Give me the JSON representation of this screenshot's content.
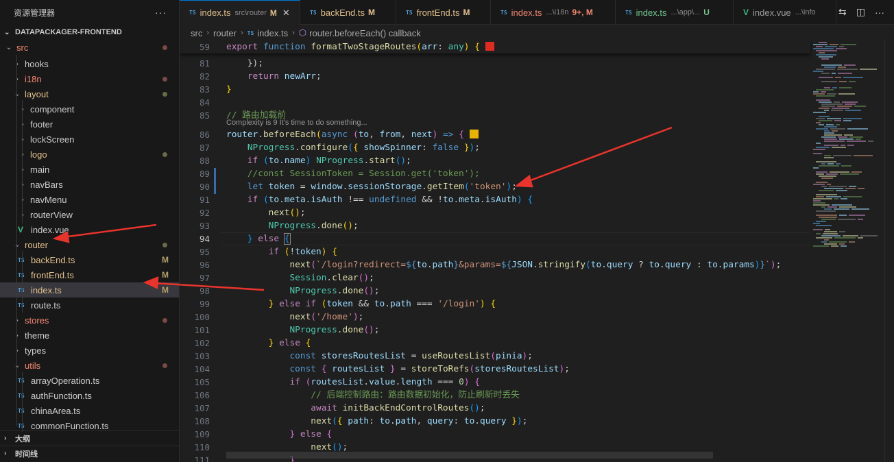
{
  "sidebar": {
    "title": "资源管理器",
    "more": "···",
    "project": "DATAPACKAGER-FRONTEND",
    "items": [
      {
        "label": "src",
        "kind": "folder-open",
        "state": "err"
      },
      {
        "label": "hooks",
        "kind": "folder",
        "state": ""
      },
      {
        "label": "i18n",
        "kind": "folder",
        "state": "err"
      },
      {
        "label": "layout",
        "kind": "folder-open",
        "state": "mod"
      },
      {
        "label": "component",
        "kind": "folder",
        "state": ""
      },
      {
        "label": "footer",
        "kind": "folder",
        "state": ""
      },
      {
        "label": "lockScreen",
        "kind": "folder",
        "state": ""
      },
      {
        "label": "logo",
        "kind": "folder",
        "state": "mod"
      },
      {
        "label": "main",
        "kind": "folder",
        "state": ""
      },
      {
        "label": "navBars",
        "kind": "folder",
        "state": ""
      },
      {
        "label": "navMenu",
        "kind": "folder",
        "state": ""
      },
      {
        "label": "routerView",
        "kind": "folder",
        "state": ""
      },
      {
        "label": "index.vue",
        "kind": "vue",
        "state": ""
      },
      {
        "label": "router",
        "kind": "folder-open",
        "state": "mod"
      },
      {
        "label": "backEnd.ts",
        "kind": "ts",
        "state": "mod",
        "badge": "M"
      },
      {
        "label": "frontEnd.ts",
        "kind": "ts",
        "state": "mod",
        "badge": "M"
      },
      {
        "label": "index.ts",
        "kind": "ts",
        "state": "mod",
        "badge": "M"
      },
      {
        "label": "route.ts",
        "kind": "ts",
        "state": ""
      },
      {
        "label": "stores",
        "kind": "folder",
        "state": "err"
      },
      {
        "label": "theme",
        "kind": "folder",
        "state": ""
      },
      {
        "label": "types",
        "kind": "folder",
        "state": ""
      },
      {
        "label": "utils",
        "kind": "folder-open",
        "state": "err"
      },
      {
        "label": "arrayOperation.ts",
        "kind": "ts",
        "state": ""
      },
      {
        "label": "authFunction.ts",
        "kind": "ts",
        "state": ""
      },
      {
        "label": "chinaArea.ts",
        "kind": "ts",
        "state": ""
      },
      {
        "label": "commonFunction.ts",
        "kind": "ts",
        "state": ""
      }
    ],
    "outline": "大纲",
    "timeline": "时间线"
  },
  "tabs": [
    {
      "icon": "TS",
      "name": "index.ts",
      "path": "src\\router",
      "status": "M",
      "active": true,
      "state": "mod"
    },
    {
      "icon": "TS",
      "name": "backEnd.ts",
      "path": "",
      "status": "M",
      "active": false,
      "state": "mod"
    },
    {
      "icon": "TS",
      "name": "frontEnd.ts",
      "path": "",
      "status": "M",
      "active": false,
      "state": "mod"
    },
    {
      "icon": "TS",
      "name": "index.ts",
      "path": "...\\i18n",
      "status": "9+, M",
      "active": false,
      "state": "err"
    },
    {
      "icon": "TS",
      "name": "index.ts",
      "path": "...\\app\\...",
      "status": "U",
      "active": false,
      "state": "unt"
    },
    {
      "icon": "V",
      "name": "index.vue",
      "path": "...\\info",
      "status": "",
      "active": false,
      "state": ""
    }
  ],
  "breadcrumb": {
    "parts": [
      "src",
      "router",
      "index.ts",
      "router.beforeEach() callback"
    ]
  },
  "editor": {
    "codelens": "Complexity is 9 It's time to do something...",
    "line_numbers": [
      "59",
      "81",
      "82",
      "83",
      "84",
      "85",
      "86",
      "87",
      "88",
      "89",
      "90",
      "91",
      "92",
      "93",
      "94",
      "95",
      "96",
      "97",
      "98",
      "99",
      "100",
      "101",
      "102",
      "103",
      "104",
      "105",
      "106",
      "107",
      "108",
      "109",
      "110",
      "111"
    ],
    "current_line": "94"
  },
  "colors": {
    "accent": "#0078d4",
    "annotation_arrow": "#e8342c",
    "modified": "#e2c08d",
    "error": "#f48771"
  }
}
